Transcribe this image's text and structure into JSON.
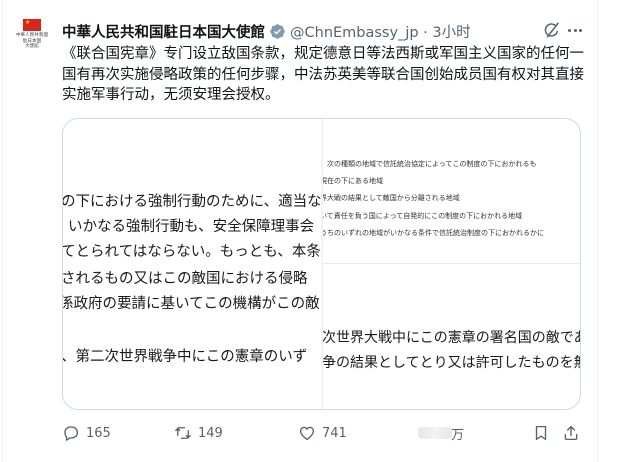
{
  "post": {
    "avatar_text": "中華人民共和国\n駐日本国\n大使館",
    "author": "中華人民共和国駐日本国大使館",
    "handle_time": "@ChnEmbassy_jp · 3小时",
    "text": "《联合国宪章》专门设立敌国条款，规定德意日等法西斯或军国主义国家的任何一国有再次实施侵略政策的任何步骤，中法苏英美等联合国创始成员国有权对其直接实施军事行动，无须安理会授权。"
  },
  "media": {
    "left_lines": [
      "の下における強制行動のために、適当な",
      "いかなる強制行動も、安全保障理事会",
      "てとられてはならない。もっとも、本条",
      "されるもの又はこの敵国における侵略",
      "係政府の要請に基いてこの機構がこの敵",
      "、第二次世界戦争中にこの憲章のいず"
    ],
    "right_small_lines": [
      "、次の種類の地域で信託統治協定によってこの制度の下におかれるも",
      "現在の下にある地域",
      "界大戦の結果として敵国から分離される地域",
      "いて責任を負う国によって自発的にこの制度の下におかれる地域",
      "うちのいずれの地域がいかなる条件で信託統治制度の下におかれるかに"
    ],
    "right_big_lines": [
      "次世界大戦中にこの憲章の署名国の敵であ",
      "争の結果としてとり又は許可したものを無"
    ]
  },
  "actions": {
    "replies": "165",
    "reposts": "149",
    "likes": "741",
    "views_tail": "万"
  },
  "icons": [
    "verified-badge-icon",
    "grok-icon",
    "more-icon",
    "reply-icon",
    "repost-icon",
    "like-icon",
    "bookmark-icon",
    "share-icon"
  ],
  "colors": {
    "verified_fill": "#829aab",
    "muted_text": "#536471",
    "flag_red": "#d8241f"
  }
}
